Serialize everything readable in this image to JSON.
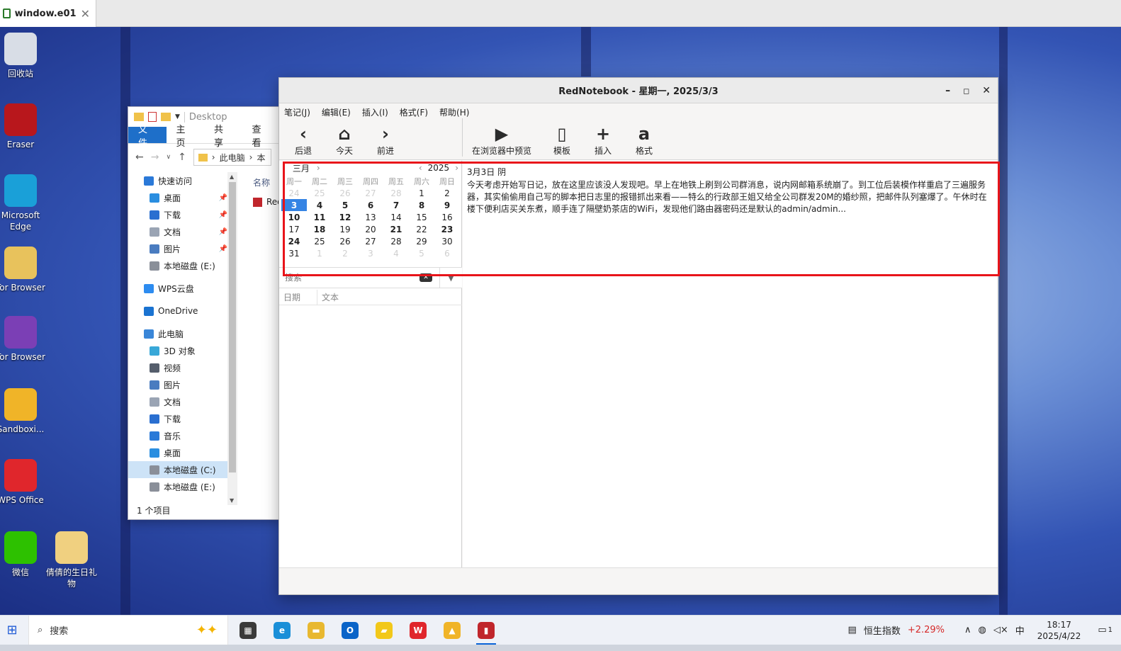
{
  "host": {
    "tab_title": "window.e01",
    "close": "✕"
  },
  "desktop_icons": [
    {
      "label": "回收站",
      "icon": "recycle-bin-icon",
      "color": "#d8dde6"
    },
    {
      "label": "Eraser",
      "icon": "eraser-icon",
      "color": "#b8171c"
    },
    {
      "label": "Microsoft Edge",
      "icon": "edge-icon",
      "color": "#1aa0d8"
    },
    {
      "label": "Tor Browser",
      "icon": "tor-folder-icon",
      "color": "#e8c25c"
    },
    {
      "label": "Tor Browser",
      "icon": "tor-icon",
      "color": "#7b3fb5"
    },
    {
      "label": "Sandboxi...",
      "icon": "sandboxie-icon",
      "color": "#f0b428"
    },
    {
      "label": "WPS Office",
      "icon": "wps-icon",
      "color": "#e0262c"
    },
    {
      "label": "微信",
      "icon": "wechat-icon",
      "color": "#2dc100"
    },
    {
      "label": "倩倩的生日礼物",
      "icon": "folder-icon",
      "color": "#f0d080"
    }
  ],
  "explorer": {
    "title": "Desktop",
    "ribbon_tabs": [
      "文件",
      "主页",
      "共享",
      "查看"
    ],
    "address": [
      "此电脑",
      "本"
    ],
    "column_header": "名称",
    "file_item": "Red",
    "tree": [
      {
        "label": "快速访问",
        "color": "#2b79d8",
        "indent": 0,
        "pin": false
      },
      {
        "label": "桌面",
        "color": "#2a8ee0",
        "indent": 1,
        "pin": true
      },
      {
        "label": "下载",
        "color": "#2a6fd0",
        "indent": 1,
        "pin": true
      },
      {
        "label": "文档",
        "color": "#9aa4b4",
        "indent": 1,
        "pin": true
      },
      {
        "label": "图片",
        "color": "#4a7cc0",
        "indent": 1,
        "pin": true
      },
      {
        "label": "本地磁盘 (E:)",
        "color": "#8a8f99",
        "indent": 1,
        "pin": false
      },
      {
        "label": "WPS云盘",
        "color": "#2d8cf0",
        "indent": 0,
        "pin": false
      },
      {
        "label": "OneDrive",
        "color": "#1a73d1",
        "indent": 0,
        "pin": false
      },
      {
        "label": "此电脑",
        "color": "#3a86d8",
        "indent": 0,
        "pin": false
      },
      {
        "label": "3D 对象",
        "color": "#38a8d8",
        "indent": 1,
        "pin": false
      },
      {
        "label": "视频",
        "color": "#555e6c",
        "indent": 1,
        "pin": false
      },
      {
        "label": "图片",
        "color": "#4a7cc0",
        "indent": 1,
        "pin": false
      },
      {
        "label": "文档",
        "color": "#9aa4b4",
        "indent": 1,
        "pin": false
      },
      {
        "label": "下载",
        "color": "#2a6fd0",
        "indent": 1,
        "pin": false
      },
      {
        "label": "音乐",
        "color": "#2a7ad8",
        "indent": 1,
        "pin": false
      },
      {
        "label": "桌面",
        "color": "#2a8ee0",
        "indent": 1,
        "pin": false
      },
      {
        "label": "本地磁盘 (C:)",
        "color": "#8a8f99",
        "indent": 1,
        "pin": false,
        "selected": true
      },
      {
        "label": "本地磁盘 (E:)",
        "color": "#8a8f99",
        "indent": 1,
        "pin": false
      }
    ],
    "status": "1 个项目"
  },
  "rednotebook": {
    "title": "RedNotebook - 星期一, 2025/3/3",
    "menu": [
      "笔记(J)",
      "编辑(E)",
      "插入(I)",
      "格式(F)",
      "帮助(H)"
    ],
    "toolbar": {
      "back": "后退",
      "today": "今天",
      "forward": "前进",
      "preview": "在浏览器中预览",
      "template": "模板",
      "insert": "插入",
      "format": "格式"
    },
    "calendar": {
      "month": "三月",
      "year": "2025",
      "weekdays": [
        "周一",
        "周二",
        "周三",
        "周四",
        "周五",
        "周六",
        "周日"
      ],
      "days": [
        {
          "d": "24",
          "t": "other"
        },
        {
          "d": "25",
          "t": "other"
        },
        {
          "d": "26",
          "t": "other"
        },
        {
          "d": "27",
          "t": "other"
        },
        {
          "d": "28",
          "t": "other"
        },
        {
          "d": "1",
          "t": ""
        },
        {
          "d": "2",
          "t": ""
        },
        {
          "d": "3",
          "t": "sel"
        },
        {
          "d": "4",
          "t": "bold"
        },
        {
          "d": "5",
          "t": "bold"
        },
        {
          "d": "6",
          "t": "bold"
        },
        {
          "d": "7",
          "t": "bold"
        },
        {
          "d": "8",
          "t": "bold"
        },
        {
          "d": "9",
          "t": "bold"
        },
        {
          "d": "10",
          "t": "bold"
        },
        {
          "d": "11",
          "t": "bold"
        },
        {
          "d": "12",
          "t": "bold"
        },
        {
          "d": "13",
          "t": ""
        },
        {
          "d": "14",
          "t": ""
        },
        {
          "d": "15",
          "t": ""
        },
        {
          "d": "16",
          "t": ""
        },
        {
          "d": "17",
          "t": ""
        },
        {
          "d": "18",
          "t": "bold"
        },
        {
          "d": "19",
          "t": ""
        },
        {
          "d": "20",
          "t": ""
        },
        {
          "d": "21",
          "t": "bold"
        },
        {
          "d": "22",
          "t": ""
        },
        {
          "d": "23",
          "t": "bold"
        },
        {
          "d": "24",
          "t": "bold"
        },
        {
          "d": "25",
          "t": ""
        },
        {
          "d": "26",
          "t": ""
        },
        {
          "d": "27",
          "t": ""
        },
        {
          "d": "28",
          "t": ""
        },
        {
          "d": "29",
          "t": ""
        },
        {
          "d": "30",
          "t": ""
        },
        {
          "d": "31",
          "t": ""
        },
        {
          "d": "1",
          "t": "other"
        },
        {
          "d": "2",
          "t": "other"
        },
        {
          "d": "3",
          "t": "other"
        },
        {
          "d": "4",
          "t": "other"
        },
        {
          "d": "5",
          "t": "other"
        },
        {
          "d": "6",
          "t": "other"
        }
      ]
    },
    "search": {
      "placeholder": "搜索"
    },
    "list_columns": [
      "日期",
      "文本"
    ],
    "editor": {
      "title": "3月3日 阴",
      "text": "今天考虑开始写日记，放在这里应该没人发现吧。早上在地铁上刷到公司群消息，说内网邮箱系统崩了。到工位后装模作样重启了三遍服务器，其实偷偷用自己写的脚本把日志里的报错抓出来看——特么的行政部王姐又给全公司群发20M的婚纱照，把邮件队列塞爆了。午休时在楼下便利店买关东煮，顺手连了隔壁奶茶店的WiFi，发现他们路由器密码还是默认的admin/admin..."
    }
  },
  "taskbar": {
    "search": "搜索",
    "apps": [
      {
        "icon": "task-view-icon",
        "color": "#3a3a3a",
        "glyph": "▦"
      },
      {
        "icon": "edge-icon",
        "color": "#1a8fd8",
        "glyph": "e"
      },
      {
        "icon": "file-explorer-icon",
        "color": "#e8b830",
        "glyph": "▬"
      },
      {
        "icon": "outlook-icon",
        "color": "#0a64c8",
        "glyph": "O"
      },
      {
        "icon": "sticky-notes-icon",
        "color": "#f2c81a",
        "glyph": "▰"
      },
      {
        "icon": "wps-icon",
        "color": "#e0262c",
        "glyph": "W"
      },
      {
        "icon": "sandboxie-icon",
        "color": "#f0b428",
        "glyph": "▲"
      },
      {
        "icon": "rednotebook-icon",
        "color": "#c0262c",
        "glyph": "▮",
        "active": true
      }
    ],
    "stock_name": "恒生指数",
    "stock_change": "+2.29%",
    "ime": "中",
    "time": "18:17",
    "date": "2025/4/22",
    "notif_count": "1"
  }
}
